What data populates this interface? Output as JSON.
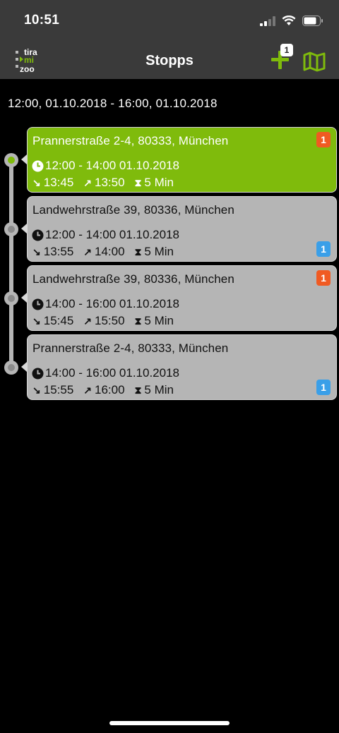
{
  "status": {
    "time": "10:51"
  },
  "nav": {
    "title": "Stopps",
    "add_badge": "1",
    "logo_text": [
      "tira",
      "mi",
      "zoo"
    ]
  },
  "range": "12:00, 01.10.2018 - 16:00, 01.10.2018",
  "stops": [
    {
      "address": "Prannerstraße 2-4, 80333, München",
      "window": "12:00 - 14:00 01.10.2018",
      "arrive": "13:45",
      "depart": "13:50",
      "duration": "5 Min",
      "badge": "1",
      "badge_color": "#f05a22",
      "state": "active"
    },
    {
      "address": "Landwehrstraße 39, 80336, München",
      "window": "12:00 - 14:00 01.10.2018",
      "arrive": "13:55",
      "depart": "14:00",
      "duration": "5 Min",
      "badge": "1",
      "badge_color": "#3a9fe8",
      "state": "normal"
    },
    {
      "address": "Landwehrstraße 39, 80336, München",
      "window": "14:00 - 16:00 01.10.2018",
      "arrive": "15:45",
      "depart": "15:50",
      "duration": "5 Min",
      "badge": "1",
      "badge_color": "#f05a22",
      "state": "normal"
    },
    {
      "address": "Prannerstraße 2-4, 80333, München",
      "window": "14:00 - 16:00 01.10.2018",
      "arrive": "15:55",
      "depart": "16:00",
      "duration": "5 Min",
      "badge": "1",
      "badge_color": "#3a9fe8",
      "state": "normal"
    }
  ],
  "colors": {
    "accent": "#7fbb0c",
    "card_gray": "#b5b5b5",
    "badge_orange": "#f05a22",
    "badge_blue": "#3a9fe8"
  }
}
